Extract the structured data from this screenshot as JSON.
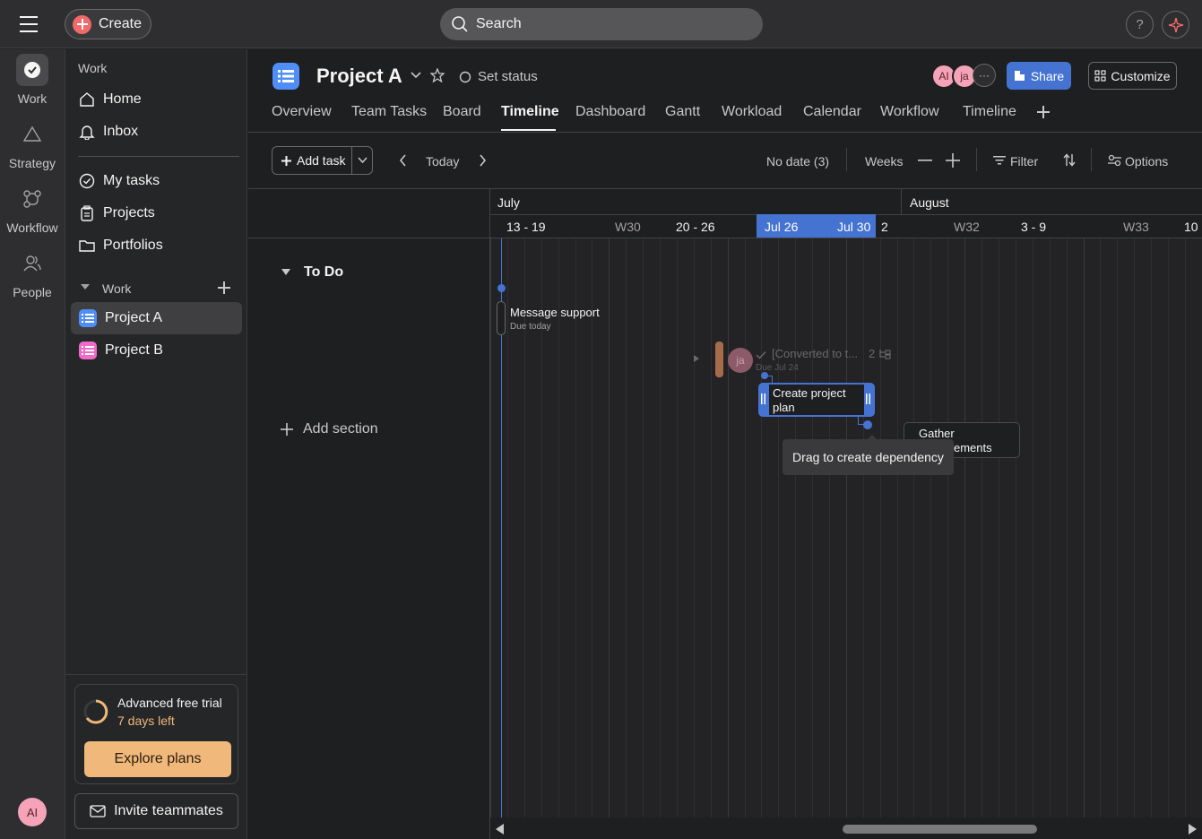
{
  "topbar": {
    "create_label": "Create",
    "search_placeholder": "Search",
    "help_label": "?"
  },
  "rail": {
    "items": [
      {
        "label": "Work",
        "icon": "check-circle-icon"
      },
      {
        "label": "Strategy",
        "icon": "triangle-icon"
      },
      {
        "label": "Workflow",
        "icon": "workflow-icon"
      },
      {
        "label": "People",
        "icon": "people-icon"
      }
    ],
    "user_initials": "AI"
  },
  "sidebar": {
    "section_title": "Work",
    "nav": [
      {
        "label": "Home",
        "icon": "home-icon"
      },
      {
        "label": "Inbox",
        "icon": "bell-icon"
      }
    ],
    "nav2": [
      {
        "label": "My tasks",
        "icon": "check-circle-icon"
      },
      {
        "label": "Projects",
        "icon": "clipboard-icon"
      },
      {
        "label": "Portfolios",
        "icon": "folder-icon"
      }
    ],
    "work_group_title": "Work",
    "projects": [
      {
        "label": "Project A",
        "color": "#4f8ef7",
        "active": true
      },
      {
        "label": "Project B",
        "color": "#f06ac9",
        "active": false
      }
    ],
    "trial": {
      "title": "Advanced free trial",
      "days_left": "7 days left",
      "explore_label": "Explore plans"
    },
    "invite_label": "Invite teammates"
  },
  "project": {
    "title": "Project A",
    "set_status": "Set status",
    "members": [
      "AI",
      "ja"
    ],
    "share_label": "Share",
    "customize_label": "Customize",
    "tabs": [
      "Overview",
      "Team Tasks",
      "Board",
      "Timeline",
      "Dashboard",
      "Gantt",
      "Workload",
      "Calendar",
      "Workflow",
      "Timeline"
    ],
    "active_tab_index": 3
  },
  "toolbar": {
    "add_task": "Add task",
    "today": "Today",
    "no_date": "No date (3)",
    "weeks": "Weeks",
    "filter": "Filter",
    "options": "Options"
  },
  "timeline": {
    "months": [
      "July",
      "August"
    ],
    "weeks": [
      "13 - 19",
      "W30",
      "20 - 26",
      "Jul 26",
      "Jul 30",
      "2",
      "W32",
      "3 - 9",
      "W33",
      "10 -"
    ],
    "section": "To Do",
    "add_section": "Add section",
    "tasks": [
      {
        "name": "Message support",
        "due": "Due today"
      },
      {
        "name": "[Converted to t...",
        "due": "Due Jul 24",
        "assignee": "ja",
        "subtasks": "2"
      },
      {
        "name": "Create project plan"
      },
      {
        "name": "Gather",
        "name2": "ements"
      }
    ],
    "tooltip": "Drag to create dependency"
  },
  "colors": {
    "accent": "#4573d2",
    "brand_create": "#f06a6a",
    "explore": "#f0b87a"
  }
}
